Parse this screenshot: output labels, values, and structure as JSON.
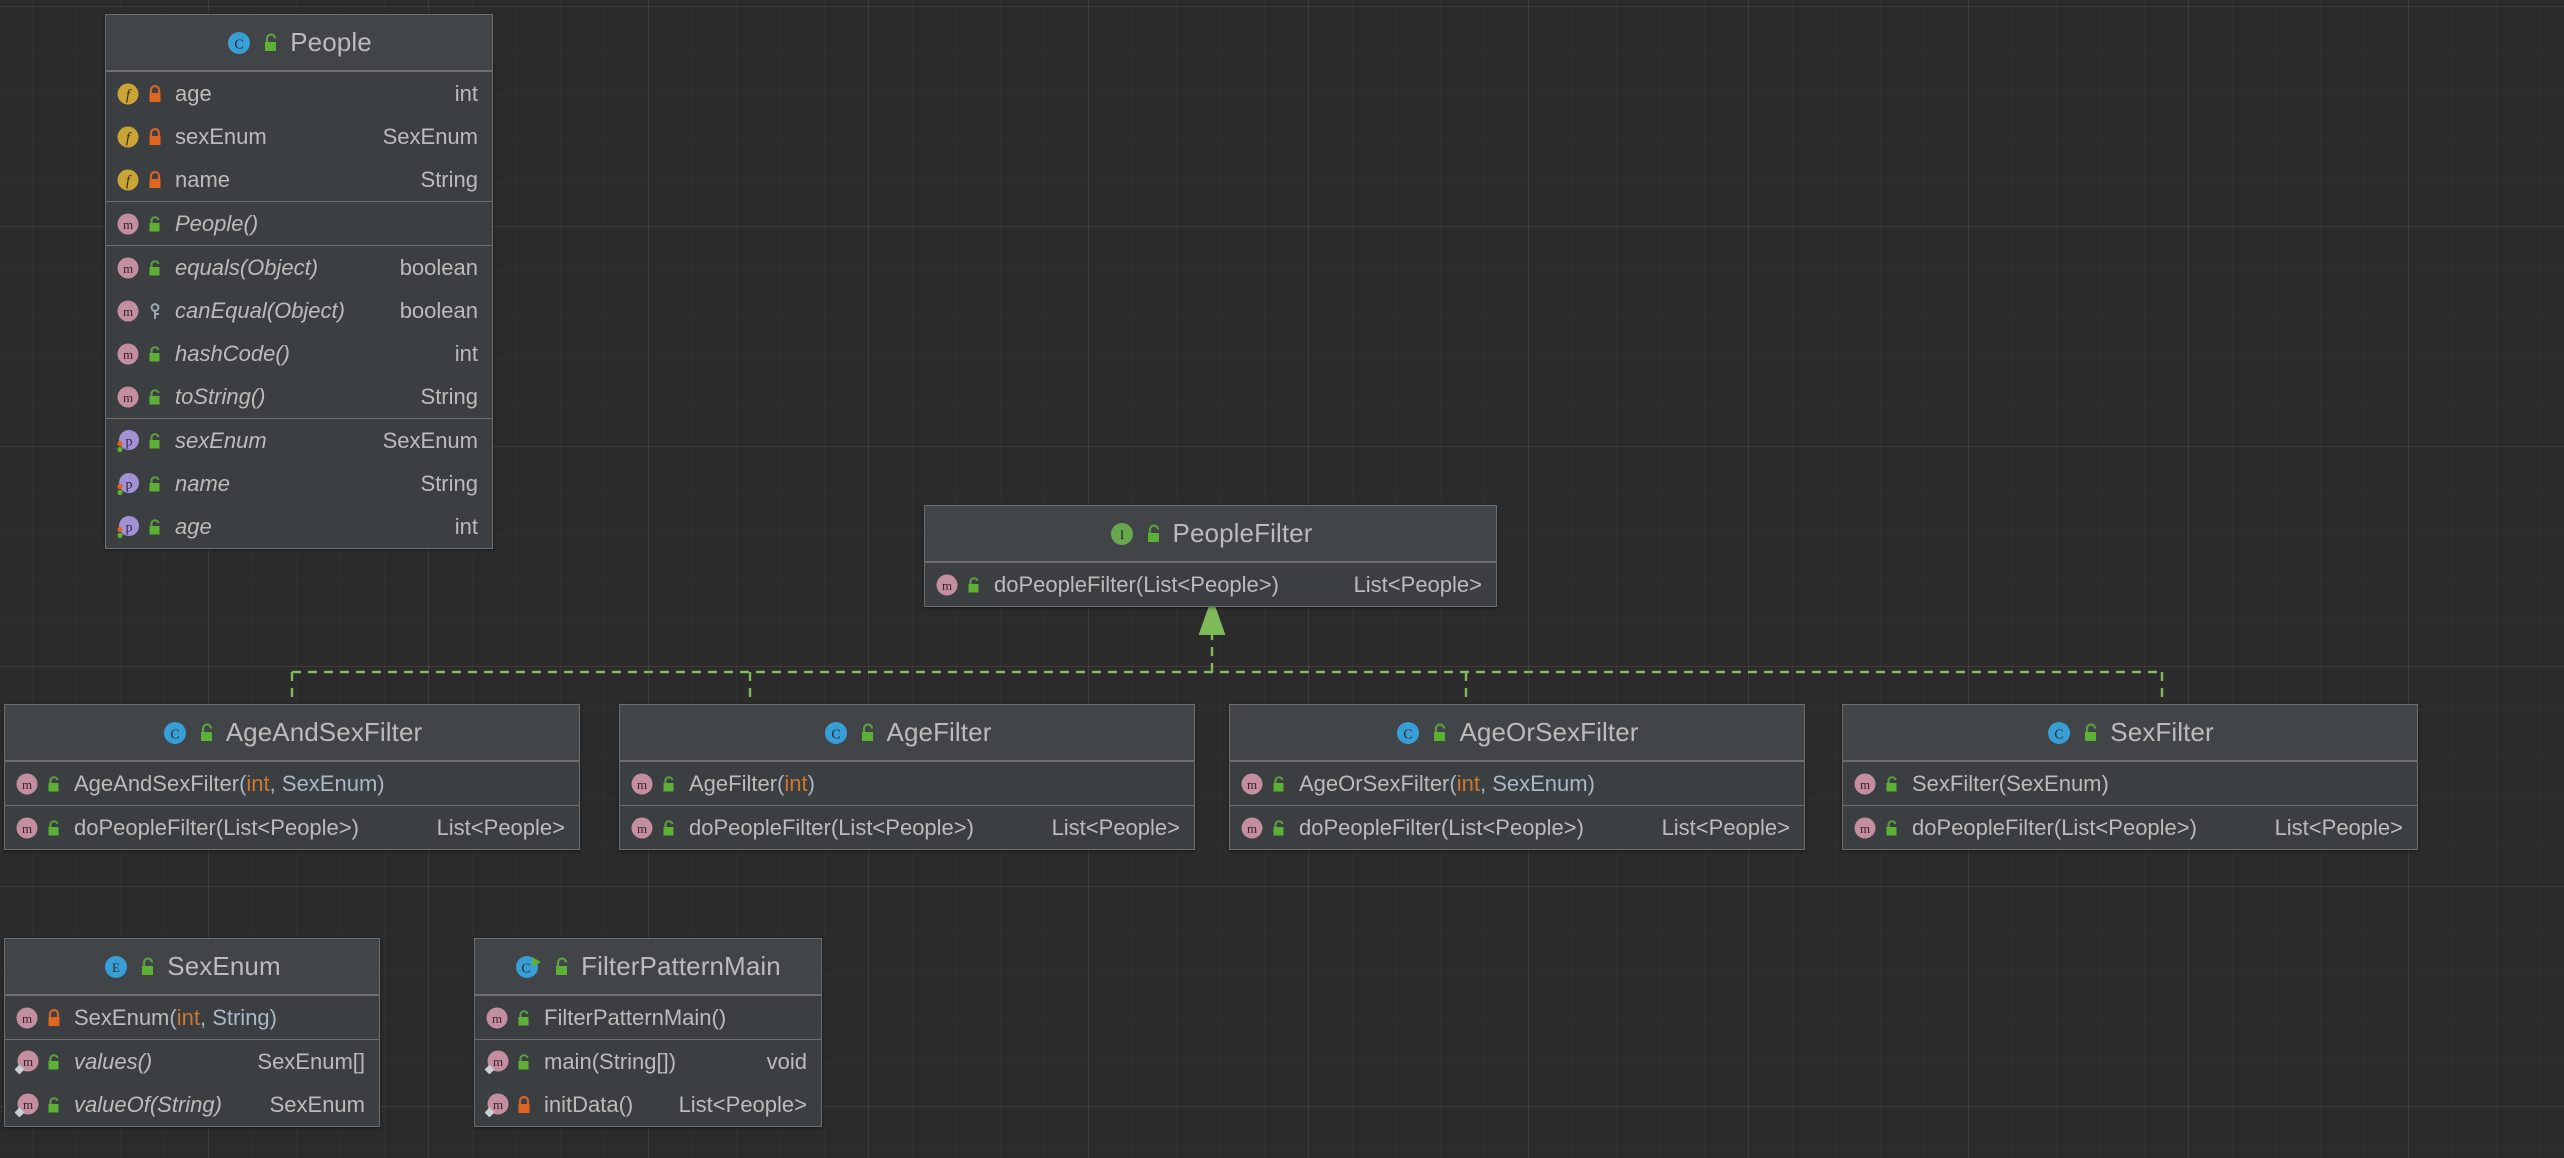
{
  "diagram": {
    "kind": "uml-class-diagram",
    "background_color": "#2b2b2b",
    "node_fill": "#3c3f41",
    "node_header_fill": "#414547",
    "node_border": "#6e6e6e",
    "edge_color": "#7fba5a",
    "accent_method": "#ffc66d",
    "accent_field": "#c9a0dc",
    "accent_primitive": "#cc7832",
    "accent_text": "#a9b7c6"
  },
  "nodes": {
    "people": {
      "title": "People",
      "stereotype_icon": "class-icon",
      "visibility_icon": "unlock-public-icon",
      "sections": [
        {
          "rows": [
            {
              "kind_icon": "field-icon",
              "vis_icon": "lock-private-icon",
              "name": "age",
              "type": "int",
              "type_kind": "primitive",
              "italic": false
            },
            {
              "kind_icon": "field-icon",
              "vis_icon": "lock-private-icon",
              "name": "sexEnum",
              "type": "SexEnum",
              "type_kind": "object",
              "italic": false
            },
            {
              "kind_icon": "field-icon",
              "vis_icon": "lock-private-icon",
              "name": "name",
              "type": "String",
              "type_kind": "object",
              "italic": false
            }
          ]
        },
        {
          "rows": [
            {
              "kind_icon": "method-icon",
              "vis_icon": "unlock-public-icon",
              "name": "People",
              "params": "()",
              "type": "",
              "type_kind": "object",
              "italic": true
            }
          ]
        },
        {
          "rows": [
            {
              "kind_icon": "method-icon",
              "vis_icon": "unlock-public-icon",
              "name": "equals",
              "params": "(Object)",
              "type": "boolean",
              "type_kind": "primitive",
              "italic": true
            },
            {
              "kind_icon": "method-icon",
              "vis_icon": "key-protected-icon",
              "name": "canEqual",
              "params": "(Object)",
              "type": "boolean",
              "type_kind": "primitive",
              "italic": true
            },
            {
              "kind_icon": "method-icon",
              "vis_icon": "unlock-public-icon",
              "name": "hashCode",
              "params": "()",
              "type": "int",
              "type_kind": "primitive",
              "italic": true
            },
            {
              "kind_icon": "method-icon",
              "vis_icon": "unlock-public-icon",
              "name": "toString",
              "params": "()",
              "type": "String",
              "type_kind": "object",
              "italic": true
            }
          ]
        },
        {
          "rows": [
            {
              "kind_icon": "property-icon",
              "vis_icon": "unlock-public-icon",
              "name": "sexEnum",
              "type": "SexEnum",
              "type_kind": "object",
              "italic": true
            },
            {
              "kind_icon": "property-icon",
              "vis_icon": "unlock-public-icon",
              "name": "name",
              "type": "String",
              "type_kind": "object",
              "italic": true
            },
            {
              "kind_icon": "property-icon",
              "vis_icon": "unlock-public-icon",
              "name": "age",
              "type": "int",
              "type_kind": "primitive",
              "italic": true
            }
          ]
        }
      ]
    },
    "peoplefilter": {
      "title": "PeopleFilter",
      "stereotype_icon": "interface-icon",
      "visibility_icon": "unlock-public-icon",
      "sections": [
        {
          "rows": [
            {
              "kind_icon": "method-icon",
              "vis_icon": "unlock-public-icon",
              "name": "doPeopleFilter",
              "params": "(List<People>)",
              "type": "List<People>",
              "type_kind": "object",
              "italic": false
            }
          ]
        }
      ]
    },
    "ageandsexfilter": {
      "title": "AgeAndSexFilter",
      "stereotype_icon": "class-icon",
      "visibility_icon": "unlock-public-icon",
      "sections": [
        {
          "rows": [
            {
              "kind_icon": "method-icon",
              "vis_icon": "unlock-public-icon",
              "name": "AgeAndSexFilter",
              "params": "(int, SexEnum)",
              "param_prim": "int",
              "type": "",
              "type_kind": "object",
              "italic": false
            }
          ]
        },
        {
          "rows": [
            {
              "kind_icon": "method-icon",
              "vis_icon": "unlock-public-icon",
              "name": "doPeopleFilter",
              "params": "(List<People>)",
              "type": "List<People>",
              "type_kind": "object",
              "italic": false
            }
          ]
        }
      ]
    },
    "agefilter": {
      "title": "AgeFilter",
      "stereotype_icon": "class-icon",
      "visibility_icon": "unlock-public-icon",
      "sections": [
        {
          "rows": [
            {
              "kind_icon": "method-icon",
              "vis_icon": "unlock-public-icon",
              "name": "AgeFilter",
              "params": "(int)",
              "param_prim": "int",
              "type": "",
              "type_kind": "object",
              "italic": false
            }
          ]
        },
        {
          "rows": [
            {
              "kind_icon": "method-icon",
              "vis_icon": "unlock-public-icon",
              "name": "doPeopleFilter",
              "params": "(List<People>)",
              "type": "List<People>",
              "type_kind": "object",
              "italic": false
            }
          ]
        }
      ]
    },
    "ageorsexfilter": {
      "title": "AgeOrSexFilter",
      "stereotype_icon": "class-icon",
      "visibility_icon": "unlock-public-icon",
      "sections": [
        {
          "rows": [
            {
              "kind_icon": "method-icon",
              "vis_icon": "unlock-public-icon",
              "name": "AgeOrSexFilter",
              "params": "(int, SexEnum)",
              "param_prim": "int",
              "type": "",
              "type_kind": "object",
              "italic": false
            }
          ]
        },
        {
          "rows": [
            {
              "kind_icon": "method-icon",
              "vis_icon": "unlock-public-icon",
              "name": "doPeopleFilter",
              "params": "(List<People>)",
              "type": "List<People>",
              "type_kind": "object",
              "italic": false
            }
          ]
        }
      ]
    },
    "sexfilter": {
      "title": "SexFilter",
      "stereotype_icon": "class-icon",
      "visibility_icon": "unlock-public-icon",
      "sections": [
        {
          "rows": [
            {
              "kind_icon": "method-icon",
              "vis_icon": "unlock-public-icon",
              "name": "SexFilter",
              "params": "(SexEnum)",
              "type": "",
              "type_kind": "object",
              "italic": false
            }
          ]
        },
        {
          "rows": [
            {
              "kind_icon": "method-icon",
              "vis_icon": "unlock-public-icon",
              "name": "doPeopleFilter",
              "params": "(List<People>)",
              "type": "List<People>",
              "type_kind": "object",
              "italic": false
            }
          ]
        }
      ]
    },
    "sexenum": {
      "title": "SexEnum",
      "stereotype_icon": "enum-icon",
      "visibility_icon": "unlock-public-icon",
      "sections": [
        {
          "rows": [
            {
              "kind_icon": "method-icon",
              "vis_icon": "lock-private-icon",
              "name": "SexEnum",
              "params": "(int, String)",
              "param_prim": "int",
              "type": "",
              "type_kind": "object",
              "italic": false
            }
          ]
        },
        {
          "rows": [
            {
              "kind_icon": "method-static-icon",
              "vis_icon": "unlock-public-icon",
              "name": "values",
              "params": "()",
              "type": "SexEnum[]",
              "type_kind": "object",
              "italic": true
            },
            {
              "kind_icon": "method-static-icon",
              "vis_icon": "unlock-public-icon",
              "name": "valueOf",
              "params": "(String)",
              "type": "SexEnum",
              "type_kind": "object",
              "italic": true
            }
          ]
        }
      ]
    },
    "filterpatternmain": {
      "title": "FilterPatternMain",
      "stereotype_icon": "runnable-class-icon",
      "visibility_icon": "unlock-public-icon",
      "sections": [
        {
          "rows": [
            {
              "kind_icon": "method-icon",
              "vis_icon": "unlock-public-icon",
              "name": "FilterPatternMain",
              "params": "()",
              "type": "",
              "type_kind": "object",
              "italic": false
            }
          ]
        },
        {
          "rows": [
            {
              "kind_icon": "method-static-icon",
              "vis_icon": "unlock-public-icon",
              "name": "main",
              "params": "(String[])",
              "type": "void",
              "type_kind": "primitive",
              "italic": false
            },
            {
              "kind_icon": "method-static-icon",
              "vis_icon": "lock-private-icon",
              "name": "initData",
              "params": "()",
              "type": "List<People>",
              "type_kind": "object",
              "italic": false
            }
          ]
        }
      ]
    }
  },
  "edges": [
    {
      "from": "AgeAndSexFilter",
      "to": "PeopleFilter",
      "type": "realization"
    },
    {
      "from": "AgeFilter",
      "to": "PeopleFilter",
      "type": "realization"
    },
    {
      "from": "AgeOrSexFilter",
      "to": "PeopleFilter",
      "type": "realization"
    },
    {
      "from": "SexFilter",
      "to": "PeopleFilter",
      "type": "realization"
    }
  ]
}
